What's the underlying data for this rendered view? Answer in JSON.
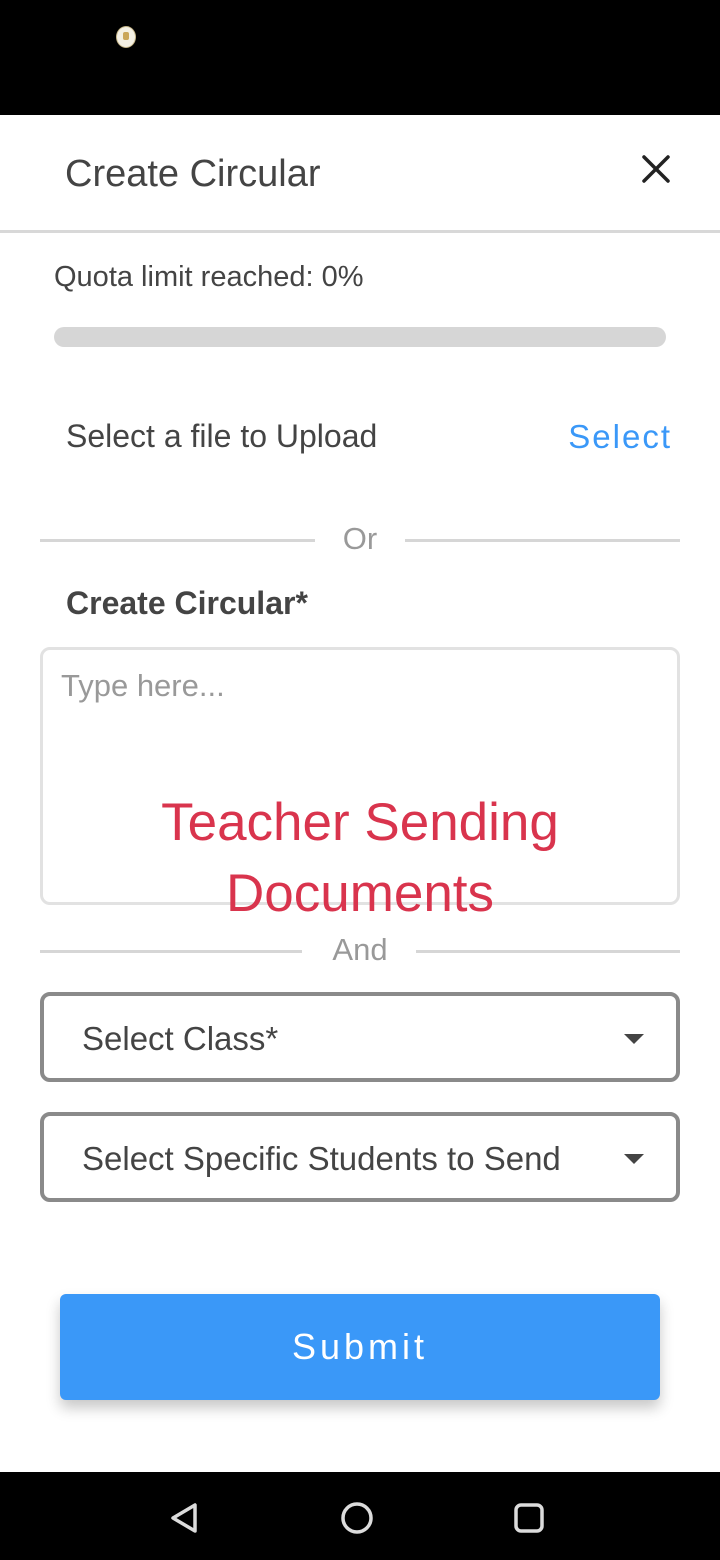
{
  "header": {
    "title": "Create Circular"
  },
  "quota": {
    "label": "Quota limit reached: 0%",
    "progress_fraction": 0
  },
  "upload": {
    "label": "Select a file to Upload",
    "select_label": "Select"
  },
  "dividers": {
    "or_label": "Or",
    "and_label": "And"
  },
  "circular": {
    "label": "Create Circular*",
    "placeholder": "Type here...",
    "value": ""
  },
  "overlay_caption": {
    "line1": "Teacher Sending",
    "line2": "Documents"
  },
  "class_select": {
    "label": "Select Class*"
  },
  "students_select": {
    "label": "Select Specific Students to Send"
  },
  "submit": {
    "label": "Submit"
  },
  "colors": {
    "accent": "#3a98f8",
    "caption_red": "#d9344d",
    "text": "#444444",
    "muted": "#999999",
    "track": "#d6d6d6"
  },
  "icons": {
    "close": "close-icon",
    "caret": "caret-down-icon",
    "nav_back": "back-triangle-icon",
    "nav_home": "home-circle-icon",
    "nav_recents": "recents-square-icon"
  }
}
